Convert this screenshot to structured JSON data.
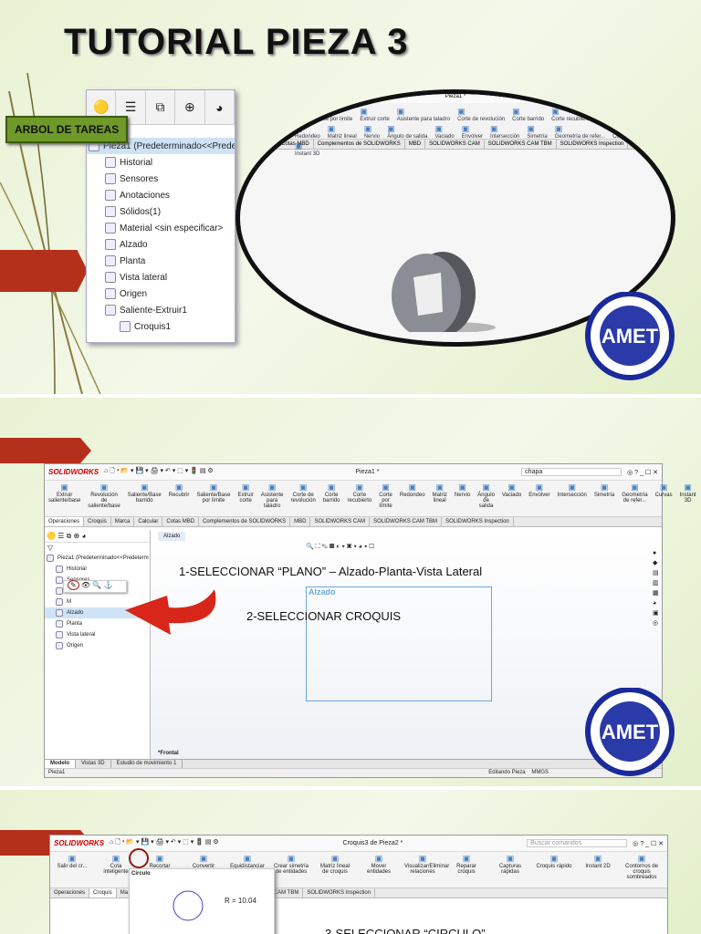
{
  "slide1": {
    "title": "TUTORIAL PIEZA 3",
    "label": "ARBOL DE TAREAS",
    "tree": [
      {
        "label": "Pieza1  (Predeterminado<<Predeterm",
        "icon": "part-icon"
      },
      {
        "label": "Historial",
        "icon": "history-folder-icon"
      },
      {
        "label": "Sensores",
        "icon": "sensors-folder-icon"
      },
      {
        "label": "Anotaciones",
        "icon": "annotations-folder-icon"
      },
      {
        "label": "Sólidos(1)",
        "icon": "solids-folder-icon"
      },
      {
        "label": "Material <sin especificar>",
        "icon": "material-icon"
      },
      {
        "label": "Alzado",
        "icon": "plane-icon"
      },
      {
        "label": "Planta",
        "icon": "plane-icon"
      },
      {
        "label": "Vista lateral",
        "icon": "plane-icon"
      },
      {
        "label": "Origen",
        "icon": "origin-icon"
      },
      {
        "label": "Saliente-Extruir1",
        "icon": "extrude-icon"
      },
      {
        "label": "Croquis1",
        "icon": "sketch-icon"
      }
    ],
    "window_title": "Pieza1 *",
    "ribbon": [
      "Saliente/Base por límite",
      "Extruir corte",
      "Asistente para taladro",
      "Corte de revolución",
      "Corte barrido",
      "Corte recubierto",
      "Corte por límite",
      "Redondeo",
      "Matriz lineal",
      "Nervio",
      "Ángulo de salida",
      "Vaciado",
      "Envolver",
      "Intersección",
      "Simetría",
      "Geometría de refer...",
      "Curvas",
      "Instant 3D"
    ],
    "tabs": [
      "Calcular",
      "Cotas MBD",
      "Complementos de SOLIDWORKS",
      "MBD",
      "SOLIDWORKS CAM",
      "SOLIDWORKS CAM TBM",
      "SOLIDWORKS Inspection"
    ]
  },
  "logo": {
    "text": "AMET",
    "ring": "ASOCIACIÓN DEL MAGISTERIO DE ENSEÑANZA TÉCNICA",
    "bottom": "REGIONAL XI - ENTRE RÍOS"
  },
  "slide2": {
    "app": "SOLIDWORKS",
    "window_title": "Pieza1 *",
    "search": "chapa",
    "ribbon": [
      "Extruir saliente/base",
      "Revolución de saliente/base",
      "Saliente/Base barrido",
      "Recubrir",
      "Saliente/Base por límite",
      "Extruir corte",
      "Asistente para taladro",
      "Corte de revolución",
      "Corte barrido",
      "Corte recubierto",
      "Corte por límite",
      "Redondeo",
      "Matriz lineal",
      "Nervio",
      "Ángulo de salida",
      "Vaciado",
      "Envolver",
      "Intersección",
      "Simetría",
      "Geometría de refer...",
      "Curvas",
      "Instant 3D"
    ],
    "tabs": [
      "Operaciones",
      "Croquis",
      "Marca",
      "Calcular",
      "Cotas MBD",
      "Complementos de SOLIDWORKS",
      "MBD",
      "SOLIDWORKS CAM",
      "SOLIDWORKS CAM TBM",
      "SOLIDWORKS Inspection"
    ],
    "tree": [
      "Pieza1  (Predeterminado<<Predeterm",
      "Historial",
      "Sensores",
      "An",
      "M",
      "Alzado",
      "Planta",
      "Vista lateral",
      "Origen"
    ],
    "breadcrumb": "Alzado",
    "plane_label": "Alzado",
    "step1": "1-SELECCIONAR “PLANO” – Alzado-Planta-Vista Lateral",
    "step2": "2-SELECCIONAR CROQUIS",
    "view": "*Frontal",
    "bottom_tabs": [
      "Modelo",
      "Vistas 3D",
      "Estudio de movimiento 1"
    ],
    "status_left": "Pieza1",
    "status_right": "Editando Pieza",
    "status_units": "MMGS"
  },
  "slide3": {
    "app": "SOLIDWORKS",
    "window_title": "Croquis3 de Pieza2 *",
    "search": "Buscar comandos",
    "ribbon": [
      "Salir del cr...",
      "Cota inteligente",
      "Recortar",
      "Convertir",
      "Equidistanciar en superficie",
      "Crear simetría de entidades",
      "Matriz lineal de croquis",
      "Mover entidades",
      "Visualizar/Eliminar relaciones",
      "Reparar croquis",
      "Capturas rápidas",
      "Croquis rápido",
      "Instant 2D",
      "Contornos de croquis sombreados"
    ],
    "tooltip": "Círculo",
    "radius": "R = 10.04",
    "tabs": [
      "Operaciones",
      "Croquis",
      "Ma",
      "RKS",
      "MBD",
      "SOLIDWORKS CAM",
      "SOLIDWORKS CAM TBM",
      "SOLIDWORKS Inspection"
    ],
    "step3": "3-SELECCIONAR “CIRCULO”"
  }
}
